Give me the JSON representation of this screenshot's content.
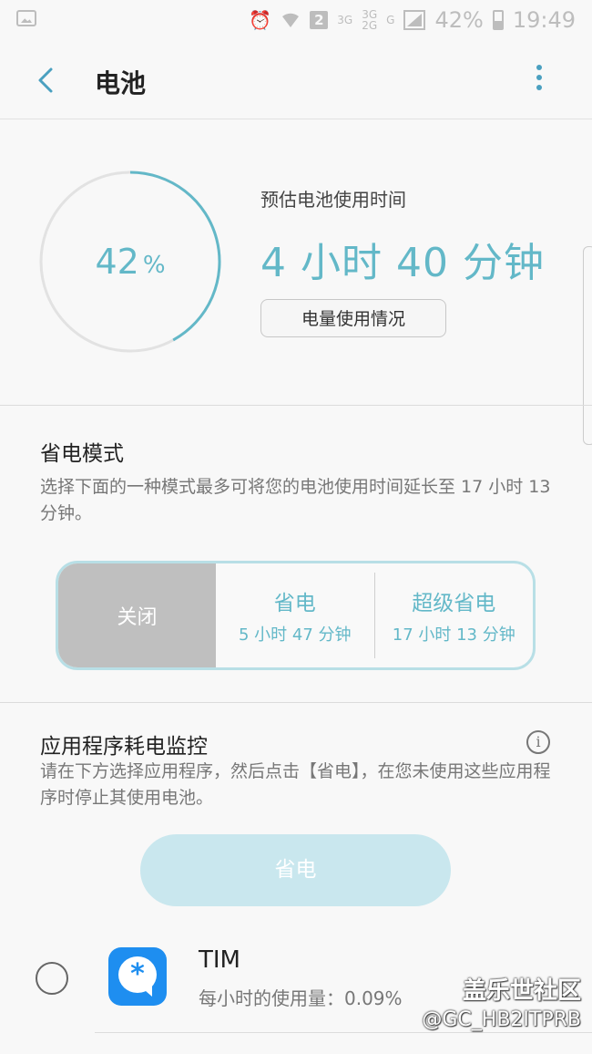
{
  "status_bar": {
    "badge": "2",
    "net1": "3G",
    "net2": "3G",
    "net3": "2G",
    "net4": "G",
    "battery": "42%",
    "time": "19:49",
    "icons": [
      "image-icon",
      "alarm-icon",
      "wifi-icon",
      "signal-icon",
      "battery-icon"
    ]
  },
  "header": {
    "title": "电池",
    "back_icon": "back-arrow-icon",
    "more_icon": "more-vert-icon"
  },
  "battery": {
    "level": 0.42,
    "percent": "42",
    "percent_sign": "%",
    "estimate_label": "预估电池使用时间",
    "estimate_value": "4 小时 40 分钟",
    "usage_button": "电量使用情况",
    "accent_color": "#63b8c8"
  },
  "power_saving": {
    "title": "省电模式",
    "description": "选择下面的一种模式最多可将您的电池使用时间延长至 17 小时 13 分钟。",
    "modes": [
      {
        "label": "关闭",
        "selected": true
      },
      {
        "label": "省电",
        "time": "5 小时 47 分钟"
      },
      {
        "label": "超级省电",
        "time": "17 小时 13 分钟"
      }
    ]
  },
  "app_monitor": {
    "title": "应用程序耗电监控",
    "info_icon": "info-icon",
    "description": "请在下方选择应用程序，然后点击【省电】，在您未使用这些应用程序时停止其使用电池。",
    "save_button": "省电",
    "apps": [
      {
        "name": "TIM",
        "usage": "每小时的使用量：0.09%",
        "icon": "tim-app-icon",
        "checked": false
      }
    ]
  },
  "watermark": {
    "line1": "盖乐世社区",
    "line2": "@GC_HB2ITPRB"
  }
}
